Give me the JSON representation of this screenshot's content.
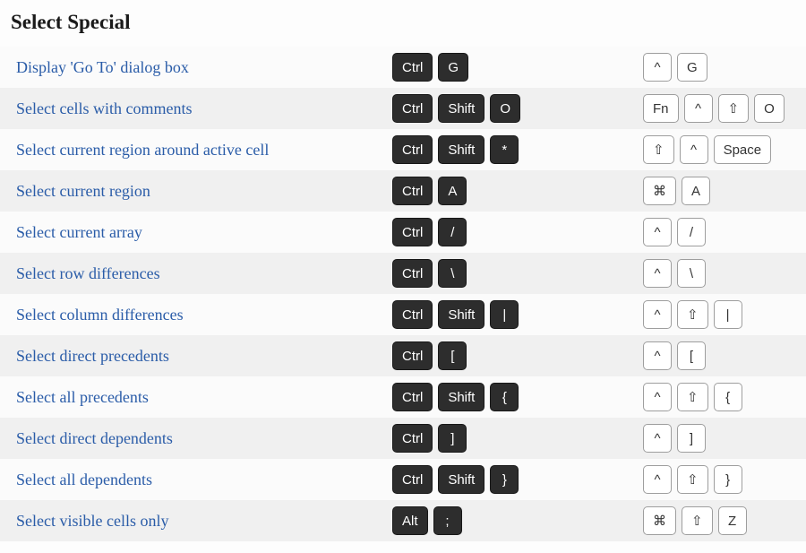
{
  "title": "Select Special",
  "rows": [
    {
      "name": "Display 'Go To' dialog box",
      "win": [
        "Ctrl",
        "G"
      ],
      "mac": [
        "^",
        "G"
      ]
    },
    {
      "name": "Select cells with comments",
      "win": [
        "Ctrl",
        "Shift",
        "O"
      ],
      "mac": [
        "Fn",
        "^",
        "⇧",
        "O"
      ]
    },
    {
      "name": "Select current region around active cell",
      "win": [
        "Ctrl",
        "Shift",
        "*"
      ],
      "mac": [
        "⇧",
        "^",
        "Space"
      ]
    },
    {
      "name": "Select current region",
      "win": [
        "Ctrl",
        "A"
      ],
      "mac": [
        "⌘",
        "A"
      ]
    },
    {
      "name": "Select current array",
      "win": [
        "Ctrl",
        "/"
      ],
      "mac": [
        "^",
        "/"
      ]
    },
    {
      "name": "Select row differences",
      "win": [
        "Ctrl",
        "\\"
      ],
      "mac": [
        "^",
        "\\"
      ]
    },
    {
      "name": "Select column differences",
      "win": [
        "Ctrl",
        "Shift",
        "|"
      ],
      "mac": [
        "^",
        "⇧",
        "|"
      ]
    },
    {
      "name": "Select direct precedents",
      "win": [
        "Ctrl",
        "["
      ],
      "mac": [
        "^",
        "["
      ]
    },
    {
      "name": "Select all precedents",
      "win": [
        "Ctrl",
        "Shift",
        "{"
      ],
      "mac": [
        "^",
        "⇧",
        "{"
      ]
    },
    {
      "name": "Select direct dependents",
      "win": [
        "Ctrl",
        "]"
      ],
      "mac": [
        "^",
        "]"
      ]
    },
    {
      "name": "Select all dependents",
      "win": [
        "Ctrl",
        "Shift",
        "}"
      ],
      "mac": [
        "^",
        "⇧",
        "}"
      ]
    },
    {
      "name": "Select visible cells only",
      "win": [
        "Alt",
        ";"
      ],
      "mac": [
        "⌘",
        "⇧",
        "Z"
      ]
    }
  ]
}
